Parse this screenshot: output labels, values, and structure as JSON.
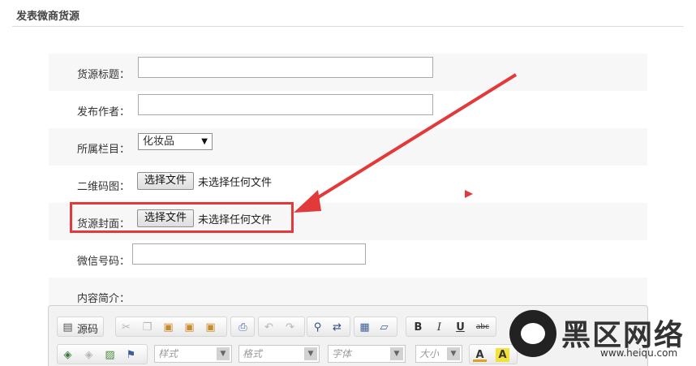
{
  "page": {
    "title": "发表微商货源"
  },
  "form": {
    "title_label": "货源标题：",
    "title_value": "",
    "author_label": "发布作者：",
    "author_value": "",
    "category_label": "所属栏目：",
    "category_selected": "化妆品",
    "qrcode_label": "二维码图：",
    "cover_label": "货源封面：",
    "file_button_label": "选择文件",
    "file_none_text": "未选择任何文件",
    "wechat_label": "微信号码：",
    "wechat_value": "",
    "content_label": "内容简介："
  },
  "editor": {
    "source_label": "源码",
    "style_placeholder": "样式",
    "format_placeholder": "格式",
    "font_placeholder": "字体",
    "size_placeholder": "大小",
    "bold": "B",
    "italic": "I",
    "underline": "U",
    "strike": "abc",
    "font_color": "A",
    "bg_color": "A"
  },
  "watermark": {
    "brand": "黑区网络",
    "url": "www.heiqu.com"
  },
  "colors": {
    "highlight": "#e23a3a",
    "arrow": "#e23a3a"
  },
  "icons": [
    "source-icon",
    "cut-icon",
    "copy-icon",
    "paste-icon",
    "paste-text-icon",
    "paste-word-icon",
    "print-icon",
    "undo-icon",
    "redo-icon",
    "find-icon",
    "replace-icon",
    "select-all-icon",
    "remove-format-icon",
    "image-icon",
    "flag-icon"
  ]
}
